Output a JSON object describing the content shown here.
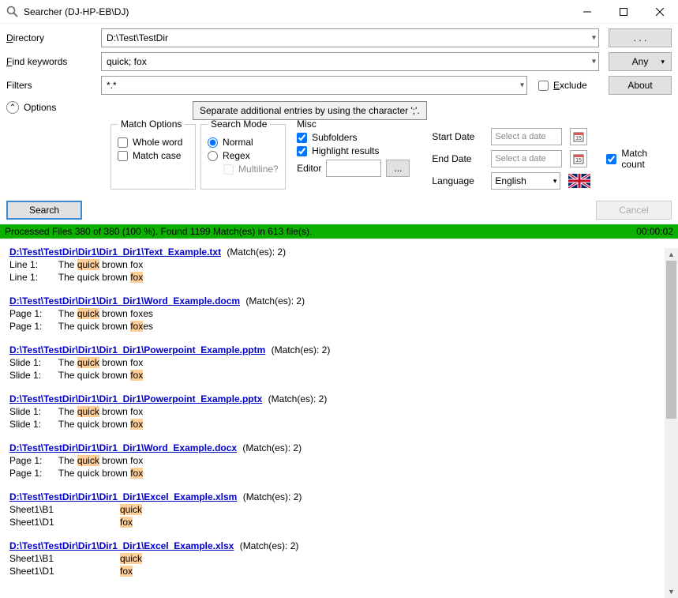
{
  "window": {
    "title": "Searcher (DJ-HP-EB\\DJ)"
  },
  "labels": {
    "directory": "Directory",
    "directory_ul": "D",
    "find": "Find keywords",
    "find_ul": "F",
    "filters": "Filters",
    "options": "Options",
    "exclude": "Exclude",
    "exclude_ul": "E",
    "dotdot": ". . .",
    "any": "Any",
    "about": "About",
    "search": "Search",
    "cancel": "Cancel"
  },
  "values": {
    "directory": "D:\\Test\\TestDir",
    "keywords": "quick; fox",
    "filters": "*.*"
  },
  "tooltip": "Separate additional entries by using the character ';'.",
  "match_options": {
    "legend": "Match Options",
    "whole_word": "Whole word",
    "whole_word_ul": "w",
    "match_case": "Match case",
    "match_case_ul": "c"
  },
  "search_mode": {
    "legend": "Search Mode",
    "normal": "Normal",
    "normal_ul": "N",
    "regex": "Regex",
    "regex_ul": "R",
    "multiline": "Multiline?",
    "multiline_ul": "M"
  },
  "misc": {
    "legend": "Misc",
    "subfolders": "Subfolders",
    "subfolders_ul": "S",
    "highlight": "Highlight results",
    "highlight_ul": "H",
    "editor": "Editor"
  },
  "dates": {
    "start": "Start Date",
    "end": "End Date",
    "placeholder": "Select a date"
  },
  "lang": {
    "label": "Language",
    "value": "English"
  },
  "match_count": "Match count",
  "status": {
    "text": "Processed Files 380 of 380 (100 %).   Found 1199 Match(es) in 613 file(s).",
    "time": "00:00:02"
  },
  "results": [
    {
      "path": "D:\\Test\\TestDir\\Dir1\\Dir1_Dir1\\Text_Example.txt",
      "matches": "(Match(es): 2)",
      "lines": [
        {
          "loc": "Line 1:",
          "pre": "The ",
          "hl": "quick",
          "post": " brown fox"
        },
        {
          "loc": "Line 1:",
          "pre": "The quick brown ",
          "hl": "fox",
          "post": ""
        }
      ]
    },
    {
      "path": "D:\\Test\\TestDir\\Dir1\\Dir1_Dir1\\Word_Example.docm",
      "matches": "(Match(es): 2)",
      "lines": [
        {
          "loc": "Page 1:",
          "pre": "The ",
          "hl": "quick",
          "post": " brown foxes"
        },
        {
          "loc": "Page 1:",
          "pre": "The quick brown ",
          "hl": "fox",
          "post": "es"
        }
      ]
    },
    {
      "path": "D:\\Test\\TestDir\\Dir1\\Dir1_Dir1\\Powerpoint_Example.pptm",
      "matches": "(Match(es): 2)",
      "lines": [
        {
          "loc": "Slide 1:",
          "pre": "The ",
          "hl": "quick",
          "post": " brown fox"
        },
        {
          "loc": "Slide 1:",
          "pre": "The quick brown ",
          "hl": "fox",
          "post": ""
        }
      ]
    },
    {
      "path": "D:\\Test\\TestDir\\Dir1\\Dir1_Dir1\\Powerpoint_Example.pptx",
      "matches": "(Match(es): 2)",
      "lines": [
        {
          "loc": "Slide 1:",
          "pre": "The ",
          "hl": "quick",
          "post": " brown fox"
        },
        {
          "loc": "Slide 1:",
          "pre": "The quick brown ",
          "hl": "fox",
          "post": ""
        }
      ]
    },
    {
      "path": "D:\\Test\\TestDir\\Dir1\\Dir1_Dir1\\Word_Example.docx",
      "matches": "(Match(es): 2)",
      "lines": [
        {
          "loc": "Page 1:",
          "pre": "The ",
          "hl": "quick",
          "post": " brown fox"
        },
        {
          "loc": "Page 1:",
          "pre": "The quick brown ",
          "hl": "fox",
          "post": ""
        }
      ]
    },
    {
      "path": "D:\\Test\\TestDir\\Dir1\\Dir1_Dir1\\Excel_Example.xlsm",
      "matches": "(Match(es): 2)",
      "lines": [
        {
          "loc": "Sheet1\\B1",
          "pre": "",
          "hl": "quick",
          "post": "",
          "wide": true
        },
        {
          "loc": "Sheet1\\D1",
          "pre": "",
          "hl": "fox",
          "post": "",
          "wide": true
        }
      ]
    },
    {
      "path": "D:\\Test\\TestDir\\Dir1\\Dir1_Dir1\\Excel_Example.xlsx",
      "matches": "(Match(es): 2)",
      "lines": [
        {
          "loc": "Sheet1\\B1",
          "pre": "",
          "hl": "quick",
          "post": "",
          "wide": true
        },
        {
          "loc": "Sheet1\\D1",
          "pre": "",
          "hl": "fox",
          "post": "",
          "wide": true
        }
      ]
    }
  ]
}
